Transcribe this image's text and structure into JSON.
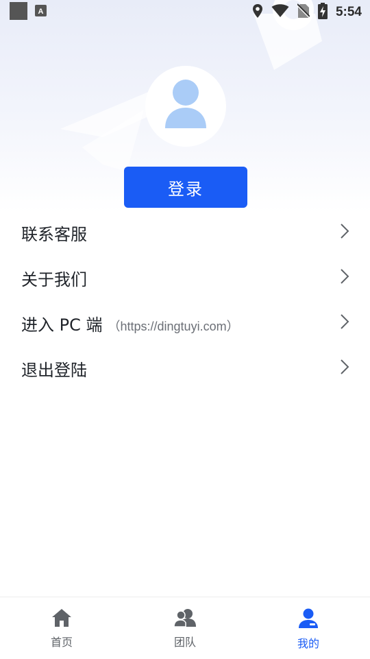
{
  "status_bar": {
    "time": "5:54",
    "icons": [
      "notification-square-icon",
      "keyboard-a-icon",
      "location-icon",
      "wifi-icon",
      "no-sim-icon",
      "battery-charging-icon"
    ]
  },
  "profile": {
    "avatar_icon": "user-avatar-icon",
    "login_label": "登录"
  },
  "menu": {
    "items": [
      {
        "label": "联系客服",
        "sub": ""
      },
      {
        "label": "关于我们",
        "sub": ""
      },
      {
        "label": "进入 PC 端",
        "sub": "（https://dingtuyi.com）"
      },
      {
        "label": "退出登陆",
        "sub": ""
      }
    ]
  },
  "tabbar": {
    "tabs": [
      {
        "label": "首页",
        "icon": "home-icon"
      },
      {
        "label": "团队",
        "icon": "team-icon"
      },
      {
        "label": "我的",
        "icon": "profile-icon"
      }
    ],
    "active_index": 2
  },
  "colors": {
    "accent": "#1a5cf5",
    "avatar": "#aaccf7",
    "tab_inactive": "#5f6368"
  }
}
